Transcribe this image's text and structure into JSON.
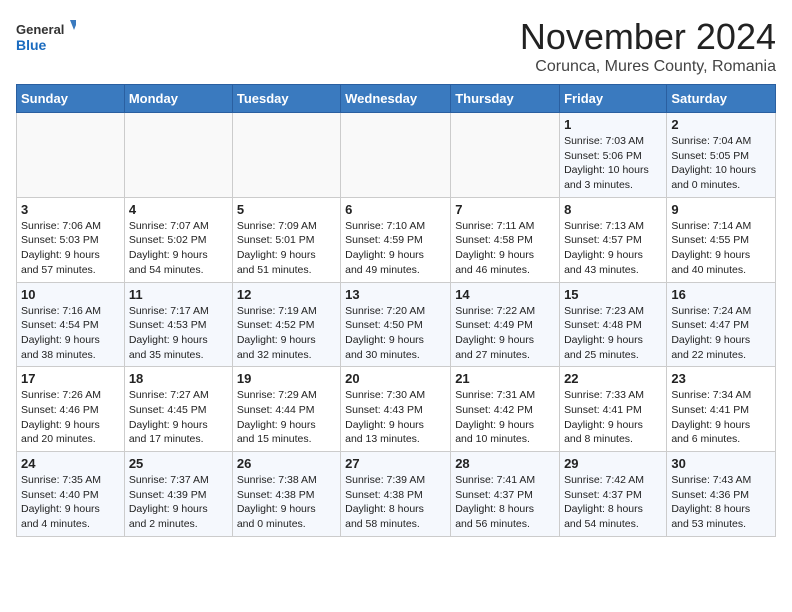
{
  "header": {
    "logo_line1": "General",
    "logo_line2": "Blue",
    "month_title": "November 2024",
    "location": "Corunca, Mures County, Romania"
  },
  "weekdays": [
    "Sunday",
    "Monday",
    "Tuesday",
    "Wednesday",
    "Thursday",
    "Friday",
    "Saturday"
  ],
  "weeks": [
    [
      {
        "day": "",
        "info": ""
      },
      {
        "day": "",
        "info": ""
      },
      {
        "day": "",
        "info": ""
      },
      {
        "day": "",
        "info": ""
      },
      {
        "day": "",
        "info": ""
      },
      {
        "day": "1",
        "info": "Sunrise: 7:03 AM\nSunset: 5:06 PM\nDaylight: 10 hours\nand 3 minutes."
      },
      {
        "day": "2",
        "info": "Sunrise: 7:04 AM\nSunset: 5:05 PM\nDaylight: 10 hours\nand 0 minutes."
      }
    ],
    [
      {
        "day": "3",
        "info": "Sunrise: 7:06 AM\nSunset: 5:03 PM\nDaylight: 9 hours\nand 57 minutes."
      },
      {
        "day": "4",
        "info": "Sunrise: 7:07 AM\nSunset: 5:02 PM\nDaylight: 9 hours\nand 54 minutes."
      },
      {
        "day": "5",
        "info": "Sunrise: 7:09 AM\nSunset: 5:01 PM\nDaylight: 9 hours\nand 51 minutes."
      },
      {
        "day": "6",
        "info": "Sunrise: 7:10 AM\nSunset: 4:59 PM\nDaylight: 9 hours\nand 49 minutes."
      },
      {
        "day": "7",
        "info": "Sunrise: 7:11 AM\nSunset: 4:58 PM\nDaylight: 9 hours\nand 46 minutes."
      },
      {
        "day": "8",
        "info": "Sunrise: 7:13 AM\nSunset: 4:57 PM\nDaylight: 9 hours\nand 43 minutes."
      },
      {
        "day": "9",
        "info": "Sunrise: 7:14 AM\nSunset: 4:55 PM\nDaylight: 9 hours\nand 40 minutes."
      }
    ],
    [
      {
        "day": "10",
        "info": "Sunrise: 7:16 AM\nSunset: 4:54 PM\nDaylight: 9 hours\nand 38 minutes."
      },
      {
        "day": "11",
        "info": "Sunrise: 7:17 AM\nSunset: 4:53 PM\nDaylight: 9 hours\nand 35 minutes."
      },
      {
        "day": "12",
        "info": "Sunrise: 7:19 AM\nSunset: 4:52 PM\nDaylight: 9 hours\nand 32 minutes."
      },
      {
        "day": "13",
        "info": "Sunrise: 7:20 AM\nSunset: 4:50 PM\nDaylight: 9 hours\nand 30 minutes."
      },
      {
        "day": "14",
        "info": "Sunrise: 7:22 AM\nSunset: 4:49 PM\nDaylight: 9 hours\nand 27 minutes."
      },
      {
        "day": "15",
        "info": "Sunrise: 7:23 AM\nSunset: 4:48 PM\nDaylight: 9 hours\nand 25 minutes."
      },
      {
        "day": "16",
        "info": "Sunrise: 7:24 AM\nSunset: 4:47 PM\nDaylight: 9 hours\nand 22 minutes."
      }
    ],
    [
      {
        "day": "17",
        "info": "Sunrise: 7:26 AM\nSunset: 4:46 PM\nDaylight: 9 hours\nand 20 minutes."
      },
      {
        "day": "18",
        "info": "Sunrise: 7:27 AM\nSunset: 4:45 PM\nDaylight: 9 hours\nand 17 minutes."
      },
      {
        "day": "19",
        "info": "Sunrise: 7:29 AM\nSunset: 4:44 PM\nDaylight: 9 hours\nand 15 minutes."
      },
      {
        "day": "20",
        "info": "Sunrise: 7:30 AM\nSunset: 4:43 PM\nDaylight: 9 hours\nand 13 minutes."
      },
      {
        "day": "21",
        "info": "Sunrise: 7:31 AM\nSunset: 4:42 PM\nDaylight: 9 hours\nand 10 minutes."
      },
      {
        "day": "22",
        "info": "Sunrise: 7:33 AM\nSunset: 4:41 PM\nDaylight: 9 hours\nand 8 minutes."
      },
      {
        "day": "23",
        "info": "Sunrise: 7:34 AM\nSunset: 4:41 PM\nDaylight: 9 hours\nand 6 minutes."
      }
    ],
    [
      {
        "day": "24",
        "info": "Sunrise: 7:35 AM\nSunset: 4:40 PM\nDaylight: 9 hours\nand 4 minutes."
      },
      {
        "day": "25",
        "info": "Sunrise: 7:37 AM\nSunset: 4:39 PM\nDaylight: 9 hours\nand 2 minutes."
      },
      {
        "day": "26",
        "info": "Sunrise: 7:38 AM\nSunset: 4:38 PM\nDaylight: 9 hours\nand 0 minutes."
      },
      {
        "day": "27",
        "info": "Sunrise: 7:39 AM\nSunset: 4:38 PM\nDaylight: 8 hours\nand 58 minutes."
      },
      {
        "day": "28",
        "info": "Sunrise: 7:41 AM\nSunset: 4:37 PM\nDaylight: 8 hours\nand 56 minutes."
      },
      {
        "day": "29",
        "info": "Sunrise: 7:42 AM\nSunset: 4:37 PM\nDaylight: 8 hours\nand 54 minutes."
      },
      {
        "day": "30",
        "info": "Sunrise: 7:43 AM\nSunset: 4:36 PM\nDaylight: 8 hours\nand 53 minutes."
      }
    ]
  ]
}
